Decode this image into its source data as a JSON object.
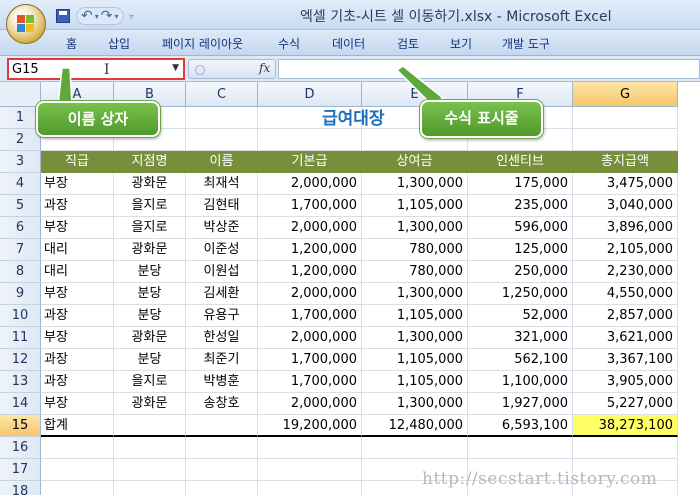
{
  "window": {
    "title": "엑셀 기초-시트 셀 이동하기.xlsx - Microsoft Excel"
  },
  "qat": {
    "undo_icon": "↶",
    "redo_icon": "↷",
    "dropdown_icon": "▾",
    "customize_icon": "▿"
  },
  "ribbon": {
    "tabs": [
      "홈",
      "삽입",
      "페이지 레이아웃",
      "수식",
      "데이터",
      "검토",
      "보기",
      "개발 도구"
    ]
  },
  "formula_bar": {
    "name_box": "G15",
    "fx_label": "fx",
    "formula": ""
  },
  "columns": [
    "A",
    "B",
    "C",
    "D",
    "E",
    "F",
    "G"
  ],
  "selected_column": "G",
  "selected_row": "15",
  "rows": [
    "1",
    "2",
    "3",
    "4",
    "5",
    "6",
    "7",
    "8",
    "9",
    "10",
    "11",
    "12",
    "13",
    "14",
    "15",
    "16",
    "17",
    "18"
  ],
  "sheet": {
    "title": "급여대장",
    "headers": [
      "직급",
      "지점명",
      "이름",
      "기본급",
      "상여금",
      "인센티브",
      "총지급액"
    ],
    "data": [
      [
        "부장",
        "광화문",
        "최재석",
        "2,000,000",
        "1,300,000",
        "175,000",
        "3,475,000"
      ],
      [
        "과장",
        "을지로",
        "김현태",
        "1,700,000",
        "1,105,000",
        "235,000",
        "3,040,000"
      ],
      [
        "부장",
        "을지로",
        "박상준",
        "2,000,000",
        "1,300,000",
        "596,000",
        "3,896,000"
      ],
      [
        "대리",
        "광화문",
        "이준성",
        "1,200,000",
        "780,000",
        "125,000",
        "2,105,000"
      ],
      [
        "대리",
        "분당",
        "이원섭",
        "1,200,000",
        "780,000",
        "250,000",
        "2,230,000"
      ],
      [
        "부장",
        "분당",
        "김세환",
        "2,000,000",
        "1,300,000",
        "1,250,000",
        "4,550,000"
      ],
      [
        "과장",
        "분당",
        "유용구",
        "1,700,000",
        "1,105,000",
        "52,000",
        "2,857,000"
      ],
      [
        "부장",
        "광화문",
        "한성일",
        "2,000,000",
        "1,300,000",
        "321,000",
        "3,621,000"
      ],
      [
        "과장",
        "분당",
        "최준기",
        "1,700,000",
        "1,105,000",
        "562,100",
        "3,367,100"
      ],
      [
        "과장",
        "을지로",
        "박병훈",
        "1,700,000",
        "1,105,000",
        "1,100,000",
        "3,905,000"
      ],
      [
        "부장",
        "광화문",
        "송창호",
        "2,000,000",
        "1,300,000",
        "1,927,000",
        "5,227,000"
      ]
    ],
    "total": [
      "합계",
      "",
      "",
      "19,200,000",
      "12,480,000",
      "6,593,100",
      "38,273,100"
    ]
  },
  "callouts": {
    "name_box": "이름 상자",
    "formula_bar": "수식 표시줄"
  },
  "watermark": "http://secstart.tistory.com",
  "colors": {
    "header_fill": "#778f3b",
    "title_text": "#1f6fbf",
    "highlight": "#ffff66",
    "callout_green": "#5fa83a",
    "namebox_border": "#e03a3a"
  }
}
